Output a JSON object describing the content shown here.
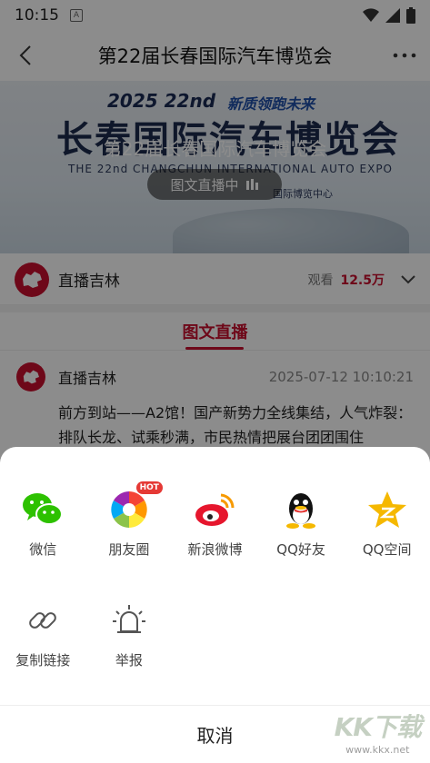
{
  "status_bar": {
    "time": "10:15",
    "notification_glyph": "A"
  },
  "nav": {
    "title": "第22届长春国际汽车博览会"
  },
  "banner": {
    "year_text": "2025 22nd",
    "slogan": "新质领跑未来",
    "big_text": "长春国际汽车博览会",
    "english": "THE 22nd CHANGCHUN INTERNATIONAL AUTO EXPO",
    "venue": "国际博览中心",
    "overlay_title": "第22届长春国际汽车博览会",
    "live_badge": "图文直播中"
  },
  "channel": {
    "name": "直播吉林",
    "viewers_label": "观看",
    "viewers_count": "12.5万"
  },
  "tab": {
    "label": "图文直播"
  },
  "post": {
    "author": "直播吉林",
    "time": "2025-07-12 10:10:21",
    "text": "前方到站——A2馆！国产新势力全线集结，人气炸裂：排队长龙、试乘秒满，市民热情把展台团团围住"
  },
  "share": {
    "row1": [
      {
        "label": "微信",
        "icon": "wechat-icon"
      },
      {
        "label": "朋友圈",
        "icon": "moments-icon",
        "badge": "HOT"
      },
      {
        "label": "新浪微博",
        "icon": "weibo-icon"
      },
      {
        "label": "QQ好友",
        "icon": "qq-icon"
      },
      {
        "label": "QQ空间",
        "icon": "qzone-icon"
      }
    ],
    "row2": [
      {
        "label": "复制链接",
        "icon": "link-icon"
      },
      {
        "label": "举报",
        "icon": "report-icon"
      }
    ],
    "cancel": "取消"
  },
  "watermark": {
    "main": "KK下载",
    "sub": "www.kkx.net"
  },
  "colors": {
    "accent": "#c8102e",
    "wechat": "#2dc100",
    "qzone": "#f5b800"
  }
}
